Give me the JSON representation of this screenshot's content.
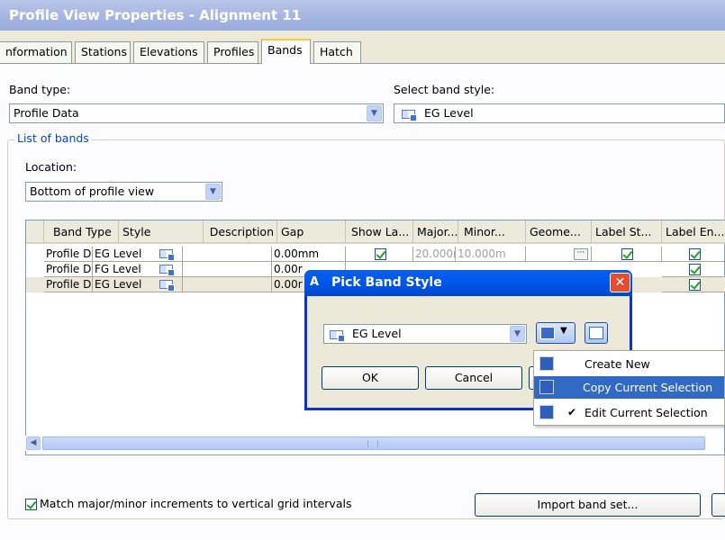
{
  "window": {
    "title": "Profile View Properties - Alignment 11"
  },
  "tabs": [
    "nformation",
    "Stations",
    "Elevations",
    "Profiles",
    "Bands",
    "Hatch"
  ],
  "band_type": {
    "label": "Band type:",
    "value": "Profile Data"
  },
  "band_style": {
    "label": "Select band style:",
    "value": "EG Level"
  },
  "list_of_bands": {
    "title": "List of bands",
    "location_label": "Location:",
    "location_value": "Bottom of profile view",
    "columns": [
      "Band Type",
      "Style",
      "Description",
      "Gap",
      "Show La...",
      "Major...",
      "Minor...",
      "Geome...",
      "Label St...",
      "Label En..."
    ],
    "rows": [
      {
        "band_type": "Profile Data",
        "style": "EG Level",
        "gap": "0.00mm",
        "major": "20.000m",
        "minor": "10.000m"
      },
      {
        "band_type": "Profile Data",
        "style": "FG Level",
        "gap": "0.00r"
      },
      {
        "band_type": "Profile Data",
        "style": "EG Level",
        "gap": "0.00r"
      }
    ]
  },
  "match_checkbox": {
    "label": "Match major/minor increments to vertical grid intervals",
    "checked": true
  },
  "import_button": "Import band set...",
  "dialog": {
    "title": "Pick Band Style",
    "style_value": "EG Level",
    "ok": "OK",
    "cancel": "Cancel"
  },
  "menu": {
    "items": [
      {
        "label": "Create New"
      },
      {
        "label": "Copy Current Selection"
      },
      {
        "label": "Edit Current Selection"
      }
    ]
  },
  "colors": {
    "title_gradient": "#a7b7e2",
    "dialog_title": "#0058ee",
    "menu_highlight": "#316ac5",
    "tab_active_accent": "#ffc83c"
  }
}
